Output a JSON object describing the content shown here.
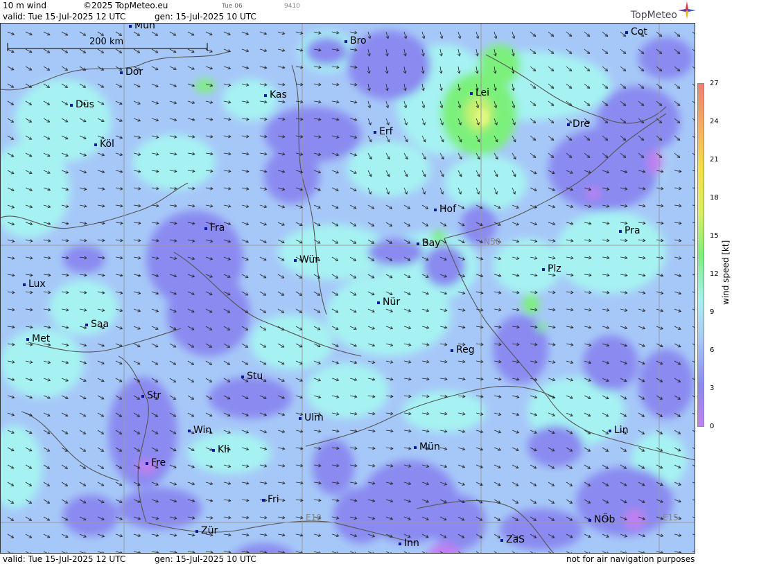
{
  "header": {
    "product": "10 m wind",
    "copyright": "©2025 TopMeteo.eu",
    "day_small": "Tue 06",
    "code_small": "9410",
    "valid": "valid:  Tue  15-Jul-2025  12 UTC",
    "gen": "gen: 15-Jul-2025 10 UTC",
    "brand": "TopMeteo"
  },
  "scale": {
    "label": "200 km"
  },
  "grid_labels": {
    "n50": "N50",
    "e10": "E10",
    "e15": "E15"
  },
  "cities": [
    {
      "name": "Mün"
    },
    {
      "name": "Bro"
    },
    {
      "name": "Cot"
    },
    {
      "name": "Dor"
    },
    {
      "name": "Kas"
    },
    {
      "name": "Lei"
    },
    {
      "name": "Düs"
    },
    {
      "name": "Erf"
    },
    {
      "name": "Dre"
    },
    {
      "name": "Köl"
    },
    {
      "name": "Hof"
    },
    {
      "name": "Fra"
    },
    {
      "name": "Pra"
    },
    {
      "name": "Bay"
    },
    {
      "name": "Wür"
    },
    {
      "name": "Plz"
    },
    {
      "name": "Lux"
    },
    {
      "name": "Nür"
    },
    {
      "name": "Saa"
    },
    {
      "name": "Met"
    },
    {
      "name": "Reg"
    },
    {
      "name": "Stu"
    },
    {
      "name": "Str"
    },
    {
      "name": "Ulm"
    },
    {
      "name": "Win"
    },
    {
      "name": "Lin"
    },
    {
      "name": "Kli"
    },
    {
      "name": "Mün"
    },
    {
      "name": "Fre"
    },
    {
      "name": "Fri"
    },
    {
      "name": "NÖb"
    },
    {
      "name": "Zür"
    },
    {
      "name": "ZaS"
    },
    {
      "name": "Inn"
    }
  ],
  "legend": {
    "title": "wind speed [kt]",
    "ticks": [
      "27",
      "24",
      "21",
      "18",
      "15",
      "12",
      "9",
      "6",
      "3",
      "0"
    ],
    "colors": [
      "#f08070",
      "#f4b060",
      "#f6e040",
      "#d8f060",
      "#7cf07c",
      "#a6f2f2",
      "#a6c8f8",
      "#8a8af0",
      "#c080f0"
    ]
  },
  "footer": {
    "valid": "valid:  Tue  15-Jul-2025  12 UTC",
    "gen": "gen: 15-Jul-2025 10 UTC",
    "note": "not for air navigation purposes"
  }
}
